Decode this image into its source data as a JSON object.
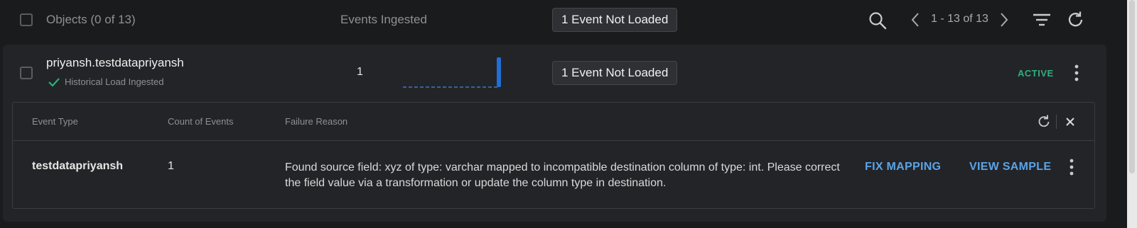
{
  "header": {
    "objects_label": "Objects (0 of 13)",
    "events_ingested_label": "Events Ingested",
    "not_loaded_badge": "1 Event Not Loaded",
    "pagination": "1 - 13 of 13",
    "icons": [
      "search-icon",
      "chevron-left-icon",
      "chevron-right-icon",
      "filter-icon",
      "refresh-icon"
    ]
  },
  "object": {
    "name": "priyansh.testdatapriyansh",
    "status_text": "Historical Load Ingested",
    "events_count": "1",
    "not_loaded_badge": "1 Event Not Loaded",
    "state": "ACTIVE",
    "sparkline": {
      "type": "bar",
      "values": [
        0,
        0,
        0,
        0,
        0,
        0,
        0,
        0,
        0,
        0,
        0,
        0,
        0,
        0,
        0,
        0,
        0,
        0,
        1
      ]
    }
  },
  "error_panel": {
    "columns": {
      "event_type": "Event Type",
      "count": "Count of Events",
      "failure_reason": "Failure Reason"
    },
    "rows": [
      {
        "event_type": "testdatapriyansh",
        "count": "1",
        "failure_reason": "Found source field: xyz of type: varchar mapped to incompatible destination column of type: int. Please correct the field value via a transformation or update the column type in destination.",
        "fix_label": "FIX MAPPING",
        "sample_label": "VIEW SAMPLE"
      }
    ]
  },
  "colors": {
    "background": "#1a1b1d",
    "card": "#232427",
    "accent_link": "#5aa3e8",
    "active_green": "#2fae7e",
    "sparkline_bar": "#1f6fd6"
  }
}
